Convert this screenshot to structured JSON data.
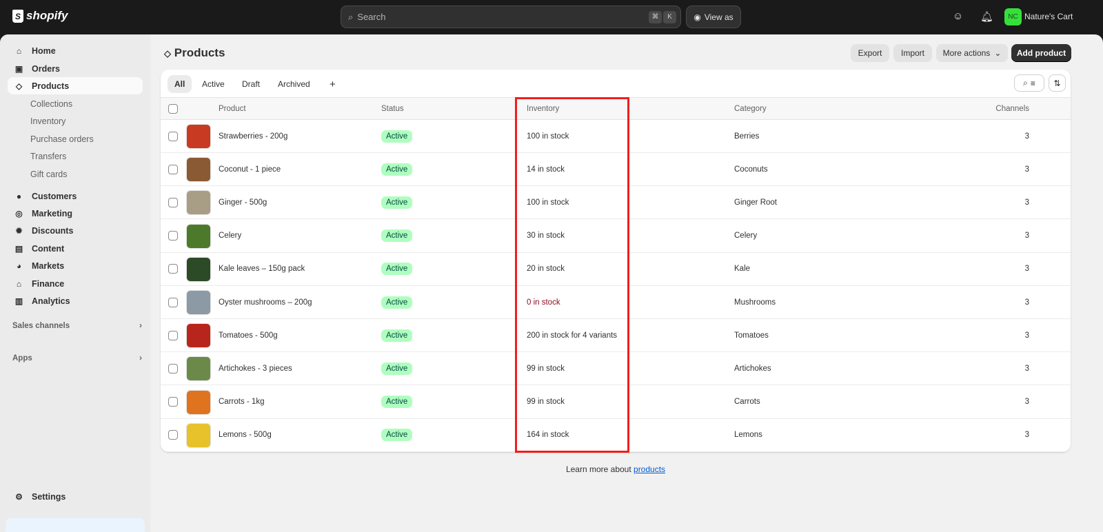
{
  "topbar": {
    "brand": "shopify",
    "search_placeholder": "Search",
    "shortcut": [
      "⌘",
      "K"
    ],
    "view_as": "View as",
    "avatar_initials": "NC",
    "store_name": "Nature's Cart",
    "accent": "#36e03a"
  },
  "sidebar": {
    "items": [
      {
        "label": "Home",
        "icon": "home-icon",
        "glyph": "⌂"
      },
      {
        "label": "Orders",
        "icon": "inbox-icon",
        "glyph": "▣"
      },
      {
        "label": "Products",
        "icon": "tag-icon",
        "glyph": "◇"
      }
    ],
    "sub_items": [
      "Collections",
      "Inventory",
      "Purchase orders",
      "Transfers",
      "Gift cards"
    ],
    "items2": [
      {
        "label": "Customers",
        "icon": "person-icon",
        "glyph": "●"
      },
      {
        "label": "Marketing",
        "icon": "target-icon",
        "glyph": "◎"
      },
      {
        "label": "Discounts",
        "icon": "discount-icon",
        "glyph": "✹"
      },
      {
        "label": "Content",
        "icon": "content-icon",
        "glyph": "▤"
      },
      {
        "label": "Markets",
        "icon": "globe-icon",
        "glyph": "◕"
      },
      {
        "label": "Finance",
        "icon": "bank-icon",
        "glyph": "⌂"
      },
      {
        "label": "Analytics",
        "icon": "chart-icon",
        "glyph": "▥"
      }
    ],
    "sales_channels": "Sales channels",
    "apps": "Apps",
    "settings": "Settings"
  },
  "page": {
    "title": "Products",
    "export": "Export",
    "import": "Import",
    "more_actions": "More actions",
    "add_product": "Add product"
  },
  "tabs": [
    "All",
    "Active",
    "Draft",
    "Archived",
    "+"
  ],
  "columns": {
    "product": "Product",
    "status": "Status",
    "inventory": "Inventory",
    "category": "Category",
    "channels": "Channels"
  },
  "rows": [
    {
      "product": "Strawberries - 200g",
      "status": "Active",
      "inventory": "100 in stock",
      "category": "Berries",
      "channels": "3",
      "color": "#c83a22"
    },
    {
      "product": "Coconut - 1 piece",
      "status": "Active",
      "inventory": "14 in stock",
      "category": "Coconuts",
      "channels": "3",
      "color": "#8a5a35"
    },
    {
      "product": "Ginger - 500g",
      "status": "Active",
      "inventory": "100 in stock",
      "category": "Ginger Root",
      "channels": "3",
      "color": "#a89e86"
    },
    {
      "product": "Celery",
      "status": "Active",
      "inventory": "30 in stock",
      "category": "Celery",
      "channels": "3",
      "color": "#4d7a2a"
    },
    {
      "product": "Kale leaves – 150g pack",
      "status": "Active",
      "inventory": "20 in stock",
      "category": "Kale",
      "channels": "3",
      "color": "#2c4a25"
    },
    {
      "product": "Oyster mushrooms – 200g",
      "status": "Active",
      "inventory": "0 in stock",
      "category": "Mushrooms",
      "channels": "3",
      "color": "#8c9aa6",
      "out": true
    },
    {
      "product": "Tomatoes - 500g",
      "status": "Active",
      "inventory": "200 in stock for 4 variants",
      "category": "Tomatoes",
      "channels": "3",
      "color": "#b8251c"
    },
    {
      "product": "Artichokes - 3 pieces",
      "status": "Active",
      "inventory": "99 in stock",
      "category": "Artichokes",
      "channels": "3",
      "color": "#6b8a4a"
    },
    {
      "product": "Carrots - 1kg",
      "status": "Active",
      "inventory": "99 in stock",
      "category": "Carrots",
      "channels": "3",
      "color": "#e0731f"
    },
    {
      "product": "Lemons - 500g",
      "status": "Active",
      "inventory": "164 in stock",
      "category": "Lemons",
      "channels": "3",
      "color": "#e8c22a"
    }
  ],
  "footer": {
    "text": "Learn more about ",
    "link": "products"
  }
}
